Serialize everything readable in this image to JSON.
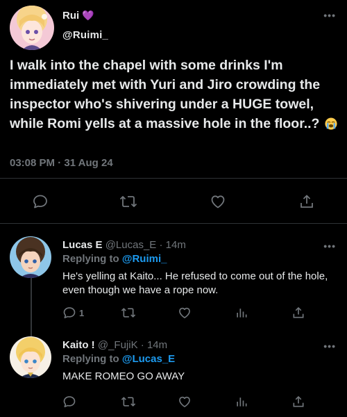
{
  "main_tweet": {
    "author_name": "Rui",
    "author_badge": "💜",
    "author_handle": "@Ruimi_",
    "text": "I walk into the chapel with some drinks I'm immediately met with Yuri and Jiro crowding the inspector who's shivering under a HUGE towel, while Romi yells at a massive hole in the floor..?",
    "emoji": "😭",
    "timestamp": "03:08 PM · 31 Aug 24",
    "more": "•••",
    "actions": [
      "reply-icon",
      "retweet-icon",
      "like-icon",
      "share-icon"
    ]
  },
  "replies": [
    {
      "author_name": "Lucas E",
      "author_handle": "@Lucas_E",
      "separator": "·",
      "time": "14m",
      "replying_label": "Replying to",
      "replying_to": "@Ruimi_",
      "text": "He's yelling at Kaito... He refused to come out of the hole, even though we have a rope now.",
      "reply_count": "1",
      "more": "•••",
      "actions": [
        "reply-icon",
        "retweet-icon",
        "like-icon",
        "stats-icon",
        "share-icon"
      ]
    },
    {
      "author_name": "Kaito !",
      "author_handle": "@_FujiK",
      "separator": "·",
      "time": "14m",
      "replying_label": "Replying to",
      "replying_to": "@Lucas_E",
      "text": "MAKE ROMEO GO AWAY",
      "reply_count": "",
      "more": "•••",
      "actions": [
        "reply-icon",
        "retweet-icon",
        "like-icon",
        "stats-icon",
        "share-icon"
      ]
    }
  ],
  "colors": {
    "background": "#000000",
    "text": "#e7e9ea",
    "secondary": "#71767b",
    "link": "#1d9bf0",
    "divider": "#2f3336",
    "heart_badge": "#b45cf0"
  }
}
